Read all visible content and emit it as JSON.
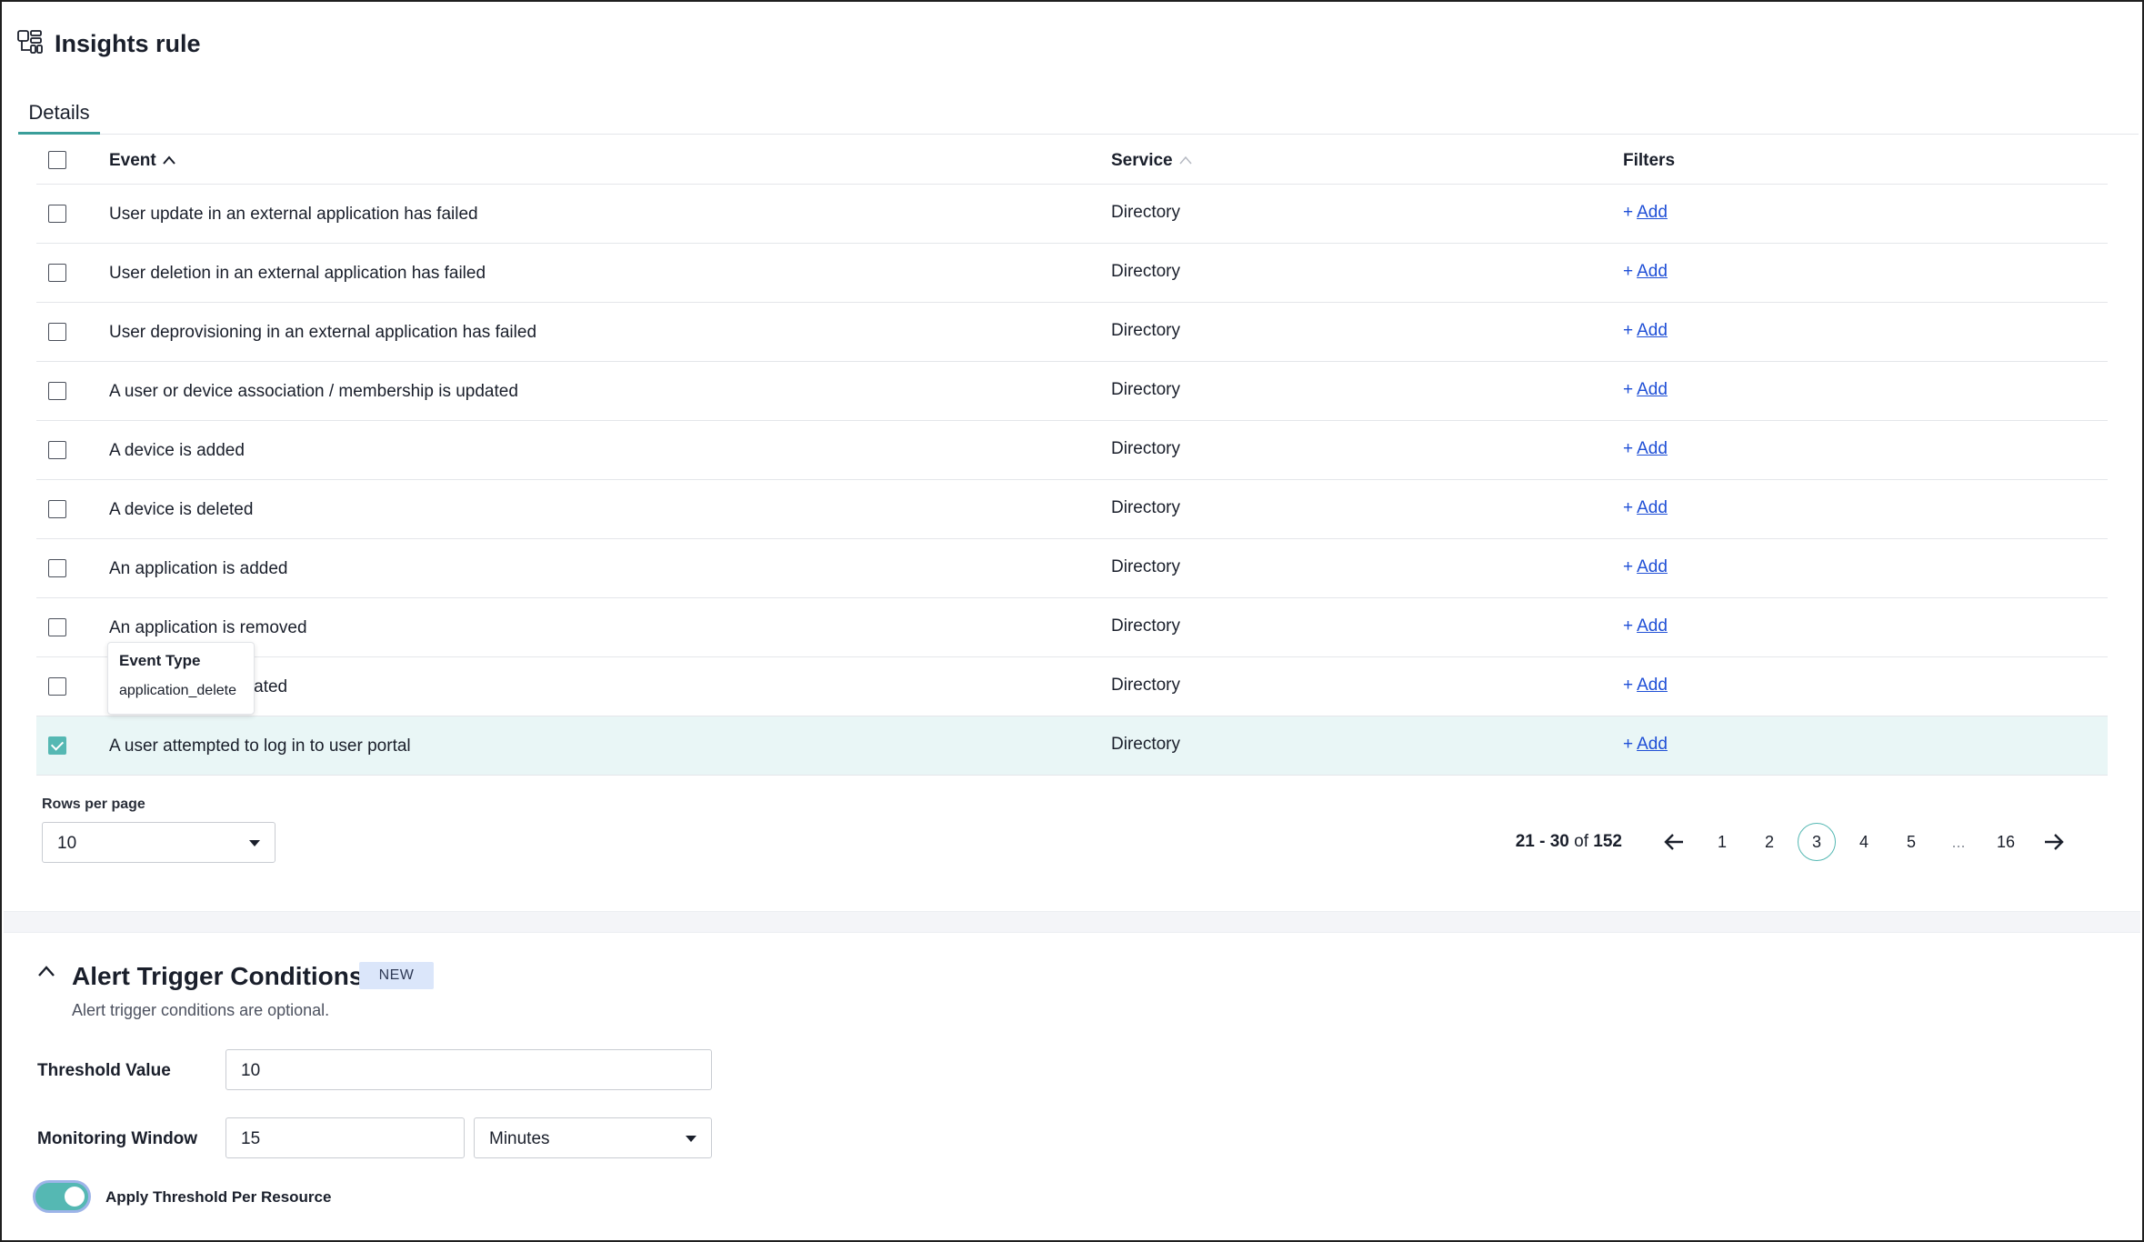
{
  "header": {
    "title": "Insights rule",
    "icon": "rule-grid-icon"
  },
  "tabs": [
    {
      "label": "Details",
      "active": true
    }
  ],
  "table": {
    "columns": {
      "event": "Event",
      "service": "Service",
      "filters": "Filters"
    },
    "rows": [
      {
        "event": "User update in an external application has failed",
        "service": "Directory",
        "filter": "Add",
        "checked": false
      },
      {
        "event": "User deletion in an external application has failed",
        "service": "Directory",
        "filter": "Add",
        "checked": false
      },
      {
        "event": "User deprovisioning in an external application has failed",
        "service": "Directory",
        "filter": "Add",
        "checked": false
      },
      {
        "event": "A user or device association / membership is updated",
        "service": "Directory",
        "filter": "Add",
        "checked": false
      },
      {
        "event": "A device is added",
        "service": "Directory",
        "filter": "Add",
        "checked": false
      },
      {
        "event": "A device is deleted",
        "service": "Directory",
        "filter": "Add",
        "checked": false
      },
      {
        "event": "An application is added",
        "service": "Directory",
        "filter": "Add",
        "checked": false
      },
      {
        "event": "An application is removed",
        "service": "Directory",
        "filter": "Add",
        "checked": false
      },
      {
        "event": "odated",
        "service": "Directory",
        "filter": "Add",
        "checked": false
      },
      {
        "event": "A user attempted to log in to user portal",
        "service": "Directory",
        "filter": "Add",
        "checked": true
      }
    ]
  },
  "tooltip": {
    "title": "Event Type",
    "value": "application_delete"
  },
  "pagination": {
    "rows_label": "Rows per page",
    "rows_value": "10",
    "range_start": "21 - 30",
    "range_of": "of",
    "range_total": "152",
    "pages": [
      "1",
      "2",
      "3",
      "4",
      "5",
      "...",
      "16"
    ],
    "current": "3"
  },
  "alert": {
    "title": "Alert Trigger Conditions",
    "badge": "NEW",
    "subtitle": "Alert trigger conditions are optional.",
    "threshold_label": "Threshold Value",
    "threshold_value": "10",
    "window_label": "Monitoring Window",
    "window_value": "15",
    "window_unit": "Minutes",
    "toggle_label": "Apply Threshold Per Resource",
    "toggle_on": true
  },
  "colors": {
    "accent": "#55b8b3",
    "link": "#1f4fd6",
    "selected_row": "#e9f6f6",
    "badge_bg": "#dbe6fa"
  }
}
